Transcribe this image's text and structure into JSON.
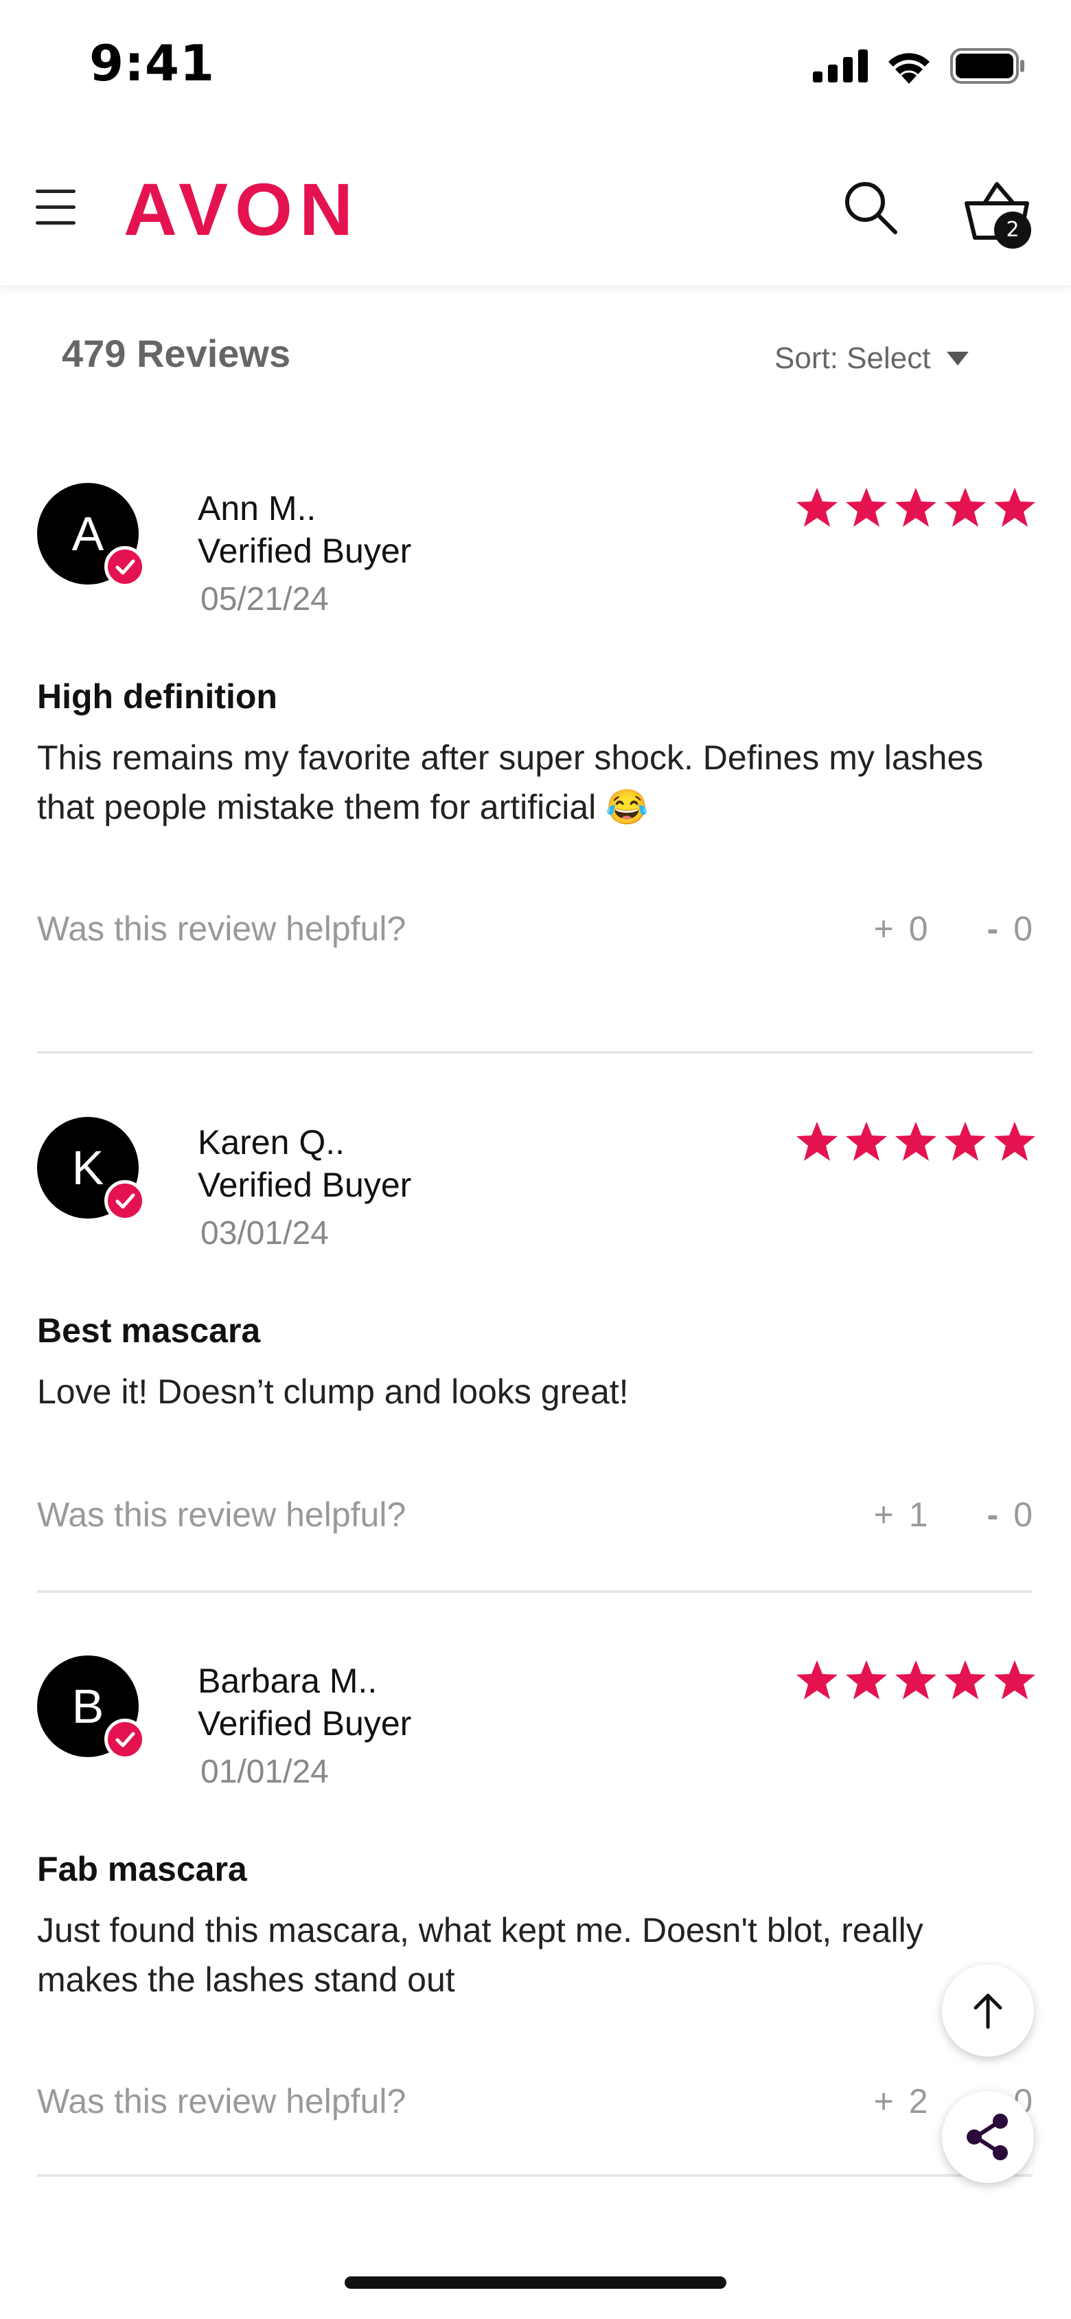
{
  "status_bar": {
    "time": "9:41"
  },
  "header": {
    "brand": "AVON",
    "cart_count": "2",
    "brand_color": "#e4134f"
  },
  "summary": {
    "reviews_count": "479 Reviews",
    "sort_label": "Sort: Select"
  },
  "reviews": [
    {
      "initial": "A",
      "name": "Ann M..",
      "status": "Verified Buyer",
      "date": "05/21/24",
      "rating": 5,
      "title": "High definition",
      "body": "This remains my favorite after super shock. Defines my lashes that people mistake them for artificial 😂",
      "helpful_label": "Was this review helpful?",
      "up_count": "0",
      "down_count": "0"
    },
    {
      "initial": "K",
      "name": "Karen Q..",
      "status": "Verified Buyer",
      "date": "03/01/24",
      "rating": 5,
      "title": "Best mascara",
      "body": "Love it! Doesn’t clump and looks great!",
      "helpful_label": "Was this review helpful?",
      "up_count": "1",
      "down_count": "0"
    },
    {
      "initial": "B",
      "name": "Barbara M..",
      "status": "Verified Buyer",
      "date": "01/01/24",
      "rating": 5,
      "title": "Fab mascara",
      "body": "Just found this mascara, what kept me. Doesn't blot, really makes the lashes stand out",
      "helpful_label": "Was this review helpful?",
      "up_count": "2",
      "down_count": "0"
    }
  ],
  "icons": {
    "menu": "menu-icon",
    "search": "search-icon",
    "cart": "cart-icon",
    "scroll_top": "arrow-up-icon",
    "share": "share-icon"
  }
}
